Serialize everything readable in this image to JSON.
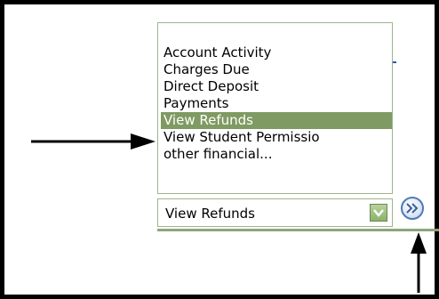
{
  "list": {
    "items": [
      {
        "label": "Account Activity",
        "selected": false
      },
      {
        "label": "Charges Due",
        "selected": false
      },
      {
        "label": "Direct Deposit",
        "selected": false
      },
      {
        "label": "Payments",
        "selected": false
      },
      {
        "label": "View Refunds",
        "selected": true
      },
      {
        "label": "View Student Permissio",
        "selected": false
      },
      {
        "label": "other financial...",
        "selected": false
      }
    ]
  },
  "select": {
    "value": "View Refunds",
    "arrow_icon": "chevron-down-icon"
  },
  "go_button": {
    "icon": "double-chevron-right-icon"
  },
  "colors": {
    "selection_bg": "#7f9a62",
    "border_green": "#9cb58a",
    "button_blue": "#4f79b8"
  }
}
